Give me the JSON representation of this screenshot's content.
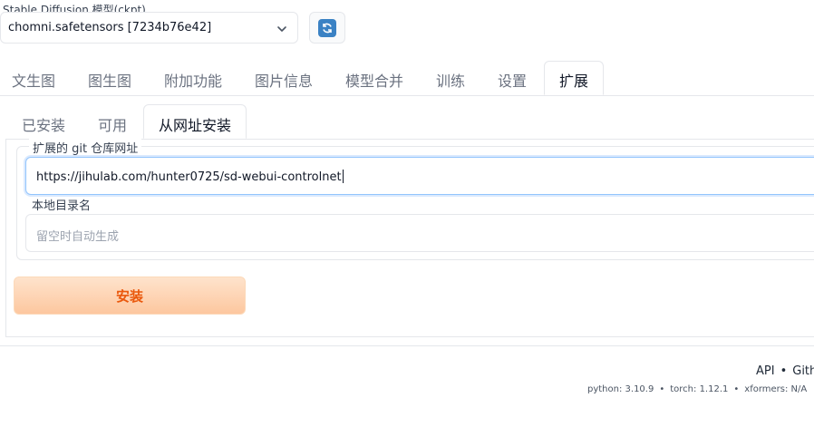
{
  "model": {
    "label": "Stable Diffusion 模型(ckpt)",
    "selected": "chomni.safetensors [7234b76e42]"
  },
  "tabs": [
    "文生图",
    "图生图",
    "附加功能",
    "图片信息",
    "模型合并",
    "训练",
    "设置",
    "扩展"
  ],
  "active_tab": "扩展",
  "subtabs": [
    "已安装",
    "可用",
    "从网址安装"
  ],
  "active_subtab": "从网址安装",
  "form": {
    "url_label": "扩展的 git 仓库网址",
    "url_value": "https://jihulab.com/hunter0725/sd-webui-controlnet",
    "dir_label": "本地目录名",
    "dir_placeholder": "留空时自动生成",
    "install_label": "安装"
  },
  "footer": {
    "links": [
      "API",
      "Githu"
    ],
    "link_separator": "•",
    "python": "python: 3.10.9",
    "torch": "torch: 1.12.1",
    "xformers": "xformers: N/A",
    "info_separator": "•"
  },
  "colors": {
    "accent": "#ea580c",
    "refresh": "#3b82c4"
  }
}
